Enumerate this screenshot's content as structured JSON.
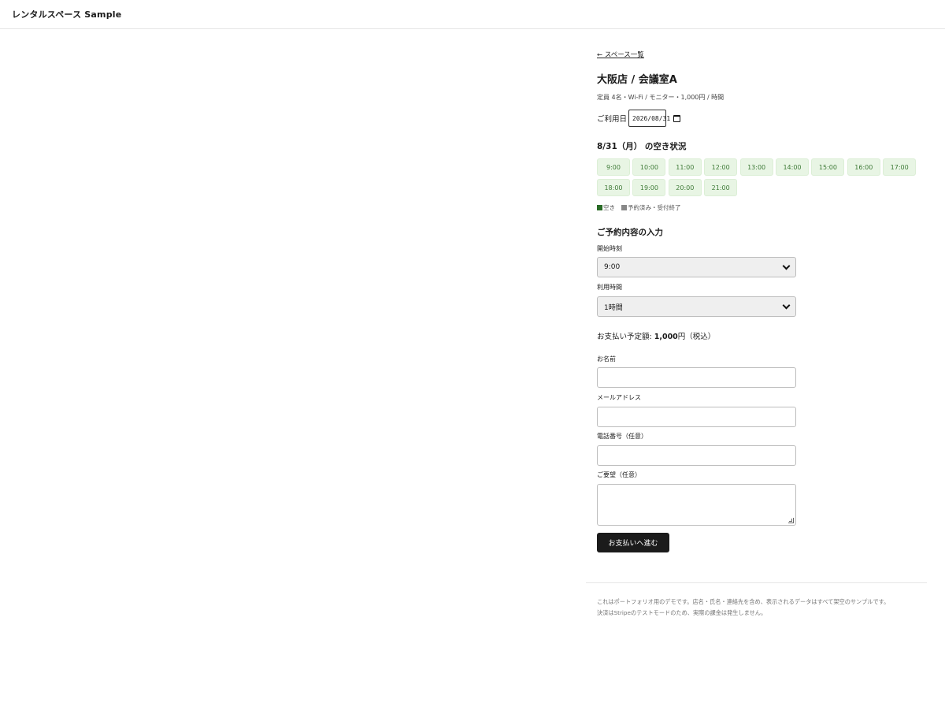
{
  "header": {
    "brand": "レンタルスペース Sample"
  },
  "nav": {
    "back_link": "← スペース一覧"
  },
  "space": {
    "title": "大阪店 / 会議室A",
    "meta": "定員 4名・Wi-Fi / モニター・1,000円 / 時間"
  },
  "date": {
    "label": "ご利用日",
    "value": "2026/08/31"
  },
  "availability": {
    "title": "8/31（月） の空き状況",
    "slots": [
      "9:00",
      "10:00",
      "11:00",
      "12:00",
      "13:00",
      "14:00",
      "15:00",
      "16:00",
      "17:00",
      "18:00",
      "19:00",
      "20:00",
      "21:00"
    ],
    "legend_available": "空き",
    "legend_booked": "予約済み・受付終了",
    "colors": {
      "available_bg": "#e8f5e4",
      "available_text": "#3e7a37",
      "available_legend": "#2a6b26",
      "booked_legend": "#888888"
    }
  },
  "form": {
    "title": "ご予約内容の入力",
    "start_label": "開始時刻",
    "start_value": "9:00",
    "duration_label": "利用時間",
    "duration_value": "1時間",
    "price_prefix": "お支払い予定額: ",
    "price_amount": "1,000",
    "price_suffix": "円（税込）",
    "name_label": "お名前",
    "email_label": "メールアドレス",
    "phone_label": "電話番号（任意）",
    "request_label": "ご要望（任意）",
    "submit_label": "お支払いへ進む"
  },
  "footer": {
    "line1": "これはポートフォリオ用のデモです。店名・氏名・連絡先を含め、表示されるデータはすべて架空のサンプルです。",
    "line2": "決済はStripeのテストモードのため、実際の課金は発生しません。"
  }
}
